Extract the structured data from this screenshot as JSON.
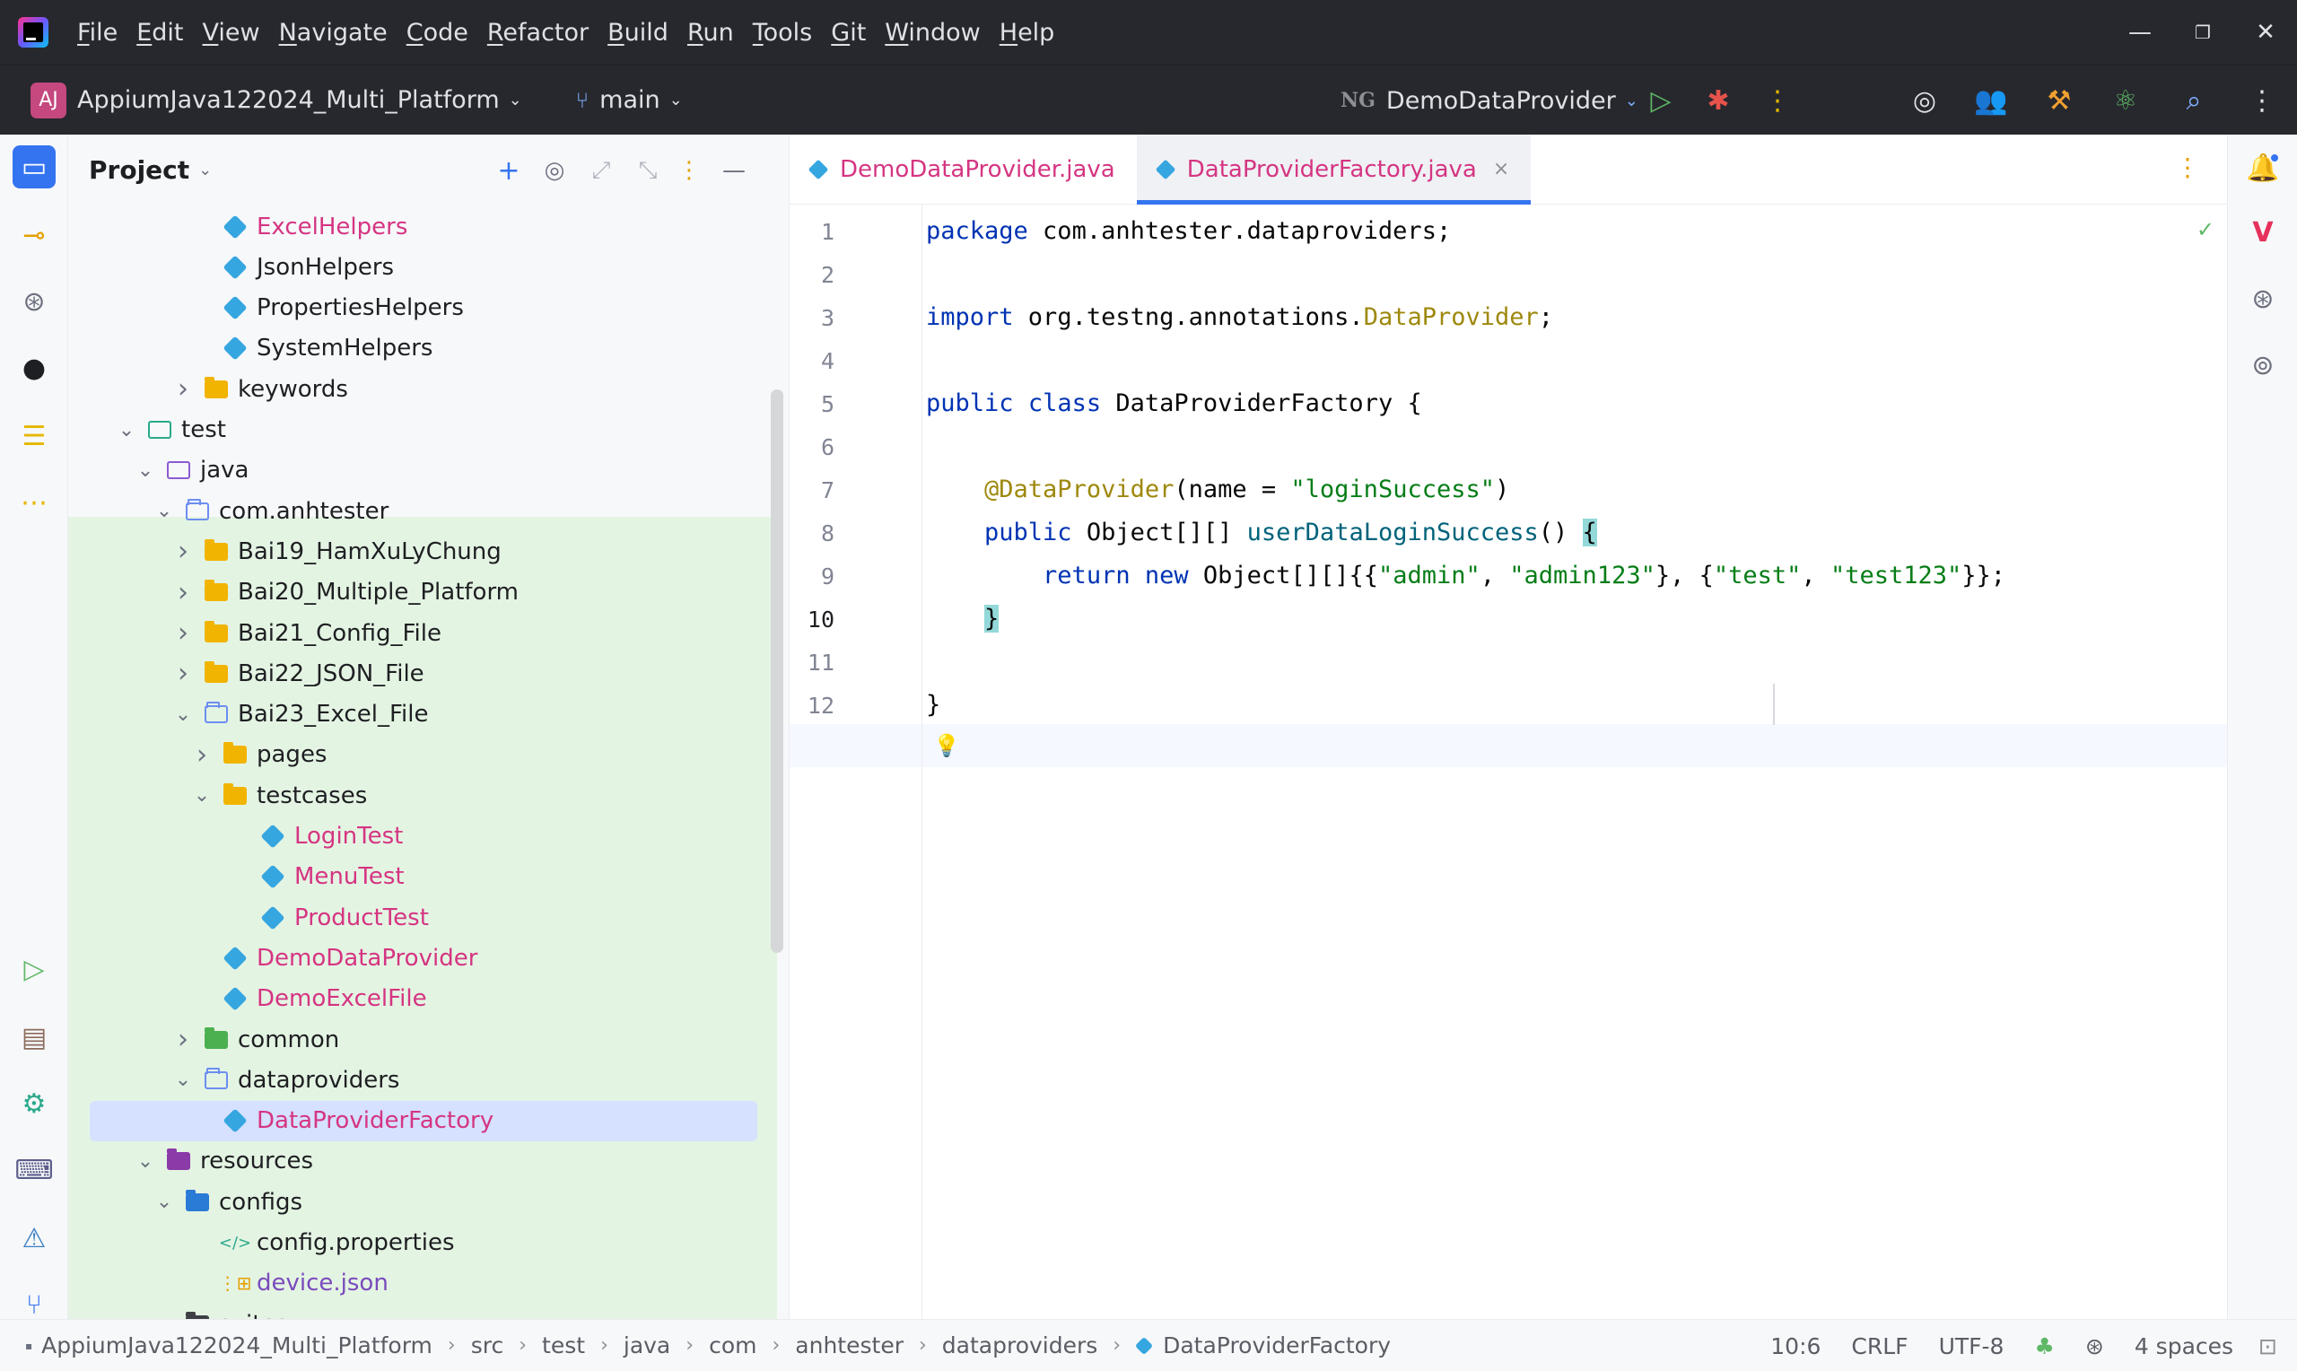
{
  "menu": [
    "File",
    "Edit",
    "View",
    "Navigate",
    "Code",
    "Refactor",
    "Build",
    "Run",
    "Tools",
    "Git",
    "Window",
    "Help"
  ],
  "window_controls": {
    "minimize": "—",
    "restore": "❐",
    "close": "✕"
  },
  "toolbar": {
    "project_initials": "AJ",
    "project_name": "AppiumJava122024_Multi_Platform",
    "branch": "main",
    "run_config": "DemoDataProvider",
    "chevron": "⌄"
  },
  "project_panel": {
    "title": "Project",
    "tree": [
      {
        "label": "ExcelHelpers",
        "type": "class",
        "depth": 7,
        "color": "pink"
      },
      {
        "label": "JsonHelpers",
        "type": "class",
        "depth": 7,
        "color": "normal"
      },
      {
        "label": "PropertiesHelpers",
        "type": "class",
        "depth": 7,
        "color": "normal"
      },
      {
        "label": "SystemHelpers",
        "type": "class",
        "depth": 7,
        "color": "normal"
      },
      {
        "label": "keywords",
        "type": "folder",
        "depth": 6,
        "arrow": "right",
        "color": "normal"
      },
      {
        "label": "test",
        "type": "test-folder",
        "depth": 3,
        "arrow": "down",
        "color": "normal"
      },
      {
        "label": "java",
        "type": "src-folder",
        "depth": 4,
        "arrow": "down",
        "color": "normal"
      },
      {
        "label": "com.anhtester",
        "type": "package",
        "depth": 5,
        "arrow": "down",
        "color": "normal"
      },
      {
        "label": "Bai19_HamXuLyChung",
        "type": "folder",
        "depth": 6,
        "arrow": "right",
        "color": "normal"
      },
      {
        "label": "Bai20_Multiple_Platform",
        "type": "folder",
        "depth": 6,
        "arrow": "right",
        "color": "normal"
      },
      {
        "label": "Bai21_Config_File",
        "type": "folder",
        "depth": 6,
        "arrow": "right",
        "color": "normal"
      },
      {
        "label": "Bai22_JSON_File",
        "type": "folder",
        "depth": 6,
        "arrow": "right",
        "color": "normal"
      },
      {
        "label": "Bai23_Excel_File",
        "type": "package",
        "depth": 6,
        "arrow": "down",
        "color": "normal"
      },
      {
        "label": "pages",
        "type": "folder",
        "depth": 7,
        "arrow": "right",
        "color": "normal"
      },
      {
        "label": "testcases",
        "type": "folder",
        "depth": 7,
        "arrow": "down",
        "color": "normal"
      },
      {
        "label": "LoginTest",
        "type": "class",
        "depth": 9,
        "color": "pink"
      },
      {
        "label": "MenuTest",
        "type": "class",
        "depth": 9,
        "color": "pink"
      },
      {
        "label": "ProductTest",
        "type": "class",
        "depth": 9,
        "color": "pink"
      },
      {
        "label": "DemoDataProvider",
        "type": "class",
        "depth": 7,
        "color": "pink"
      },
      {
        "label": "DemoExcelFile",
        "type": "class",
        "depth": 7,
        "color": "pink"
      },
      {
        "label": "common",
        "type": "green-folder",
        "depth": 6,
        "arrow": "right",
        "color": "normal"
      },
      {
        "label": "dataproviders",
        "type": "package",
        "depth": 6,
        "arrow": "down",
        "color": "normal"
      },
      {
        "label": "DataProviderFactory",
        "type": "class",
        "depth": 7,
        "color": "pink",
        "selected": true
      },
      {
        "label": "resources",
        "type": "res-folder",
        "depth": 4,
        "arrow": "down",
        "color": "normal"
      },
      {
        "label": "configs",
        "type": "cfg-folder",
        "depth": 5,
        "arrow": "down",
        "color": "normal"
      },
      {
        "label": "config.properties",
        "type": "props",
        "depth": 7,
        "color": "normal"
      },
      {
        "label": "device.json",
        "type": "json",
        "depth": 7,
        "color": "purple"
      },
      {
        "label": "suites",
        "type": "dark-folder",
        "depth": 5,
        "arrow": "down",
        "color": "normal"
      }
    ]
  },
  "editor": {
    "tabs": [
      {
        "label": "DemoDataProvider.java",
        "active": false
      },
      {
        "label": "DataProviderFactory.java",
        "active": true,
        "close": "×"
      }
    ],
    "line_numbers": [
      "1",
      "2",
      "3",
      "4",
      "5",
      "6",
      "7",
      "8",
      "9",
      "10",
      "11",
      "12"
    ],
    "current_line": "10",
    "code": [
      [
        {
          "t": "package",
          "c": "kw"
        },
        {
          "t": " com.anhtester.dataproviders;"
        }
      ],
      [],
      [
        {
          "t": "import",
          "c": "kw"
        },
        {
          "t": " org.testng.annotations."
        },
        {
          "t": "DataProvider",
          "c": "ann"
        },
        {
          "t": ";"
        }
      ],
      [],
      [
        {
          "t": "public",
          "c": "kw"
        },
        {
          "t": " "
        },
        {
          "t": "class",
          "c": "kw"
        },
        {
          "t": " DataProviderFactory {"
        }
      ],
      [],
      [
        {
          "t": "    "
        },
        {
          "t": "@DataProvider",
          "c": "ann"
        },
        {
          "t": "(name = "
        },
        {
          "t": "\"loginSuccess\"",
          "c": "str"
        },
        {
          "t": ")"
        }
      ],
      [
        {
          "t": "    "
        },
        {
          "t": "public",
          "c": "kw"
        },
        {
          "t": " Object[][] "
        },
        {
          "t": "userDataLoginSuccess",
          "c": "mth"
        },
        {
          "t": "() "
        },
        {
          "t": "{",
          "c": "brace-hl"
        }
      ],
      [
        {
          "t": "        "
        },
        {
          "t": "return",
          "c": "kw"
        },
        {
          "t": " "
        },
        {
          "t": "new",
          "c": "kw"
        },
        {
          "t": " Object[][]{{"
        },
        {
          "t": "\"admin\"",
          "c": "str"
        },
        {
          "t": ", "
        },
        {
          "t": "\"admin123\"",
          "c": "str"
        },
        {
          "t": "}, {"
        },
        {
          "t": "\"test\"",
          "c": "str"
        },
        {
          "t": ", "
        },
        {
          "t": "\"test123\"",
          "c": "str"
        },
        {
          "t": "}};"
        }
      ],
      [
        {
          "t": "    "
        },
        {
          "t": "}",
          "c": "brace-hl"
        }
      ],
      [],
      [
        {
          "t": "}"
        }
      ]
    ]
  },
  "statusbar": {
    "breadcrumbs": [
      "AppiumJava122024_Multi_Platform",
      "src",
      "test",
      "java",
      "com",
      "anhtester",
      "dataproviders",
      "DataProviderFactory"
    ],
    "separator": "›",
    "position": "10:6",
    "line_ending": "CRLF",
    "encoding": "UTF-8",
    "indent": "4 spaces"
  },
  "colors": {
    "accent": "#3574f0",
    "pink": "#d53582",
    "tree_green": "#e4f4e3",
    "selection": "#d5e1ff"
  }
}
